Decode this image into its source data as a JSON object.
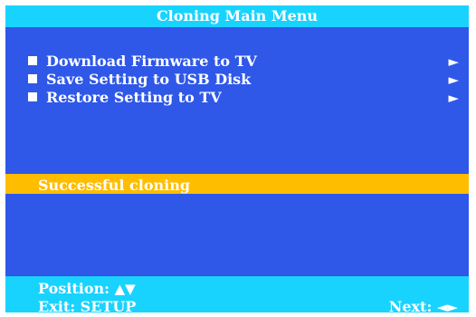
{
  "title": "Cloning Main Menu",
  "menu": {
    "items": [
      {
        "label": "Download Firmware to TV",
        "arrow": "►"
      },
      {
        "label": "Save Setting to USB Disk",
        "arrow": "►"
      },
      {
        "label": "Restore Setting to TV",
        "arrow": "►"
      }
    ]
  },
  "status": {
    "message": "Successful cloning"
  },
  "footer": {
    "position_label": "Position:",
    "position_glyphs": "▲▼",
    "exit_label": "Exit: SETUP",
    "next_label": "Next:",
    "next_glyphs": "◄►"
  },
  "colors": {
    "background": "#2f58e8",
    "title_bar": "#19d3ff",
    "status_bar": "#ffbd00",
    "text": "#ffffff"
  }
}
